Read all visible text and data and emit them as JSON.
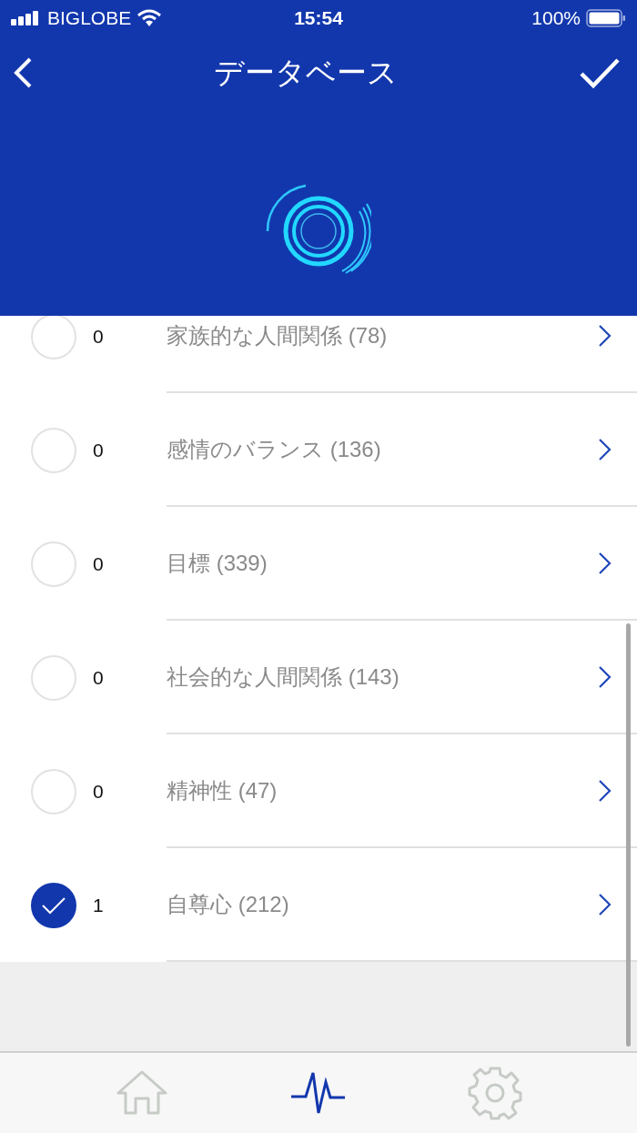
{
  "status_bar": {
    "carrier": "BIGLOBE",
    "time": "15:54",
    "battery": "100%"
  },
  "nav": {
    "title": "データベース"
  },
  "items": [
    {
      "checked": false,
      "count": "0",
      "label": "家族的な人間関係 (78)"
    },
    {
      "checked": false,
      "count": "0",
      "label": "感情のバランス (136)"
    },
    {
      "checked": false,
      "count": "0",
      "label": "目標 (339)"
    },
    {
      "checked": false,
      "count": "0",
      "label": "社会的な人間関係 (143)"
    },
    {
      "checked": false,
      "count": "0",
      "label": "精神性 (47)"
    },
    {
      "checked": true,
      "count": "1",
      "label": "自尊心 (212)"
    }
  ],
  "tab_bar": [
    {
      "kind": "home",
      "selected": false
    },
    {
      "kind": "pulse",
      "selected": true
    },
    {
      "kind": "settings",
      "selected": false
    }
  ]
}
